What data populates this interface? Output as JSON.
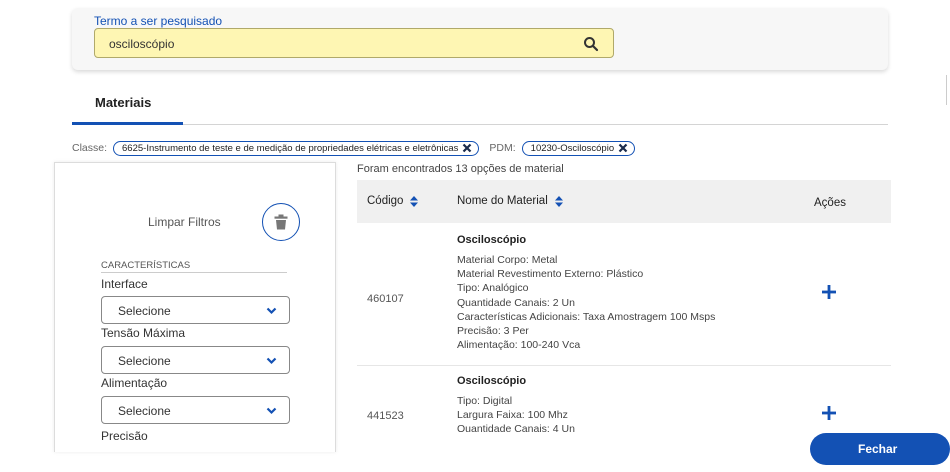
{
  "search": {
    "label": "Termo a ser pesquisado",
    "value": "osciloscópio"
  },
  "tab": {
    "label": "Materiais"
  },
  "filters": {
    "classe_key": "Classe:",
    "classe_value": "6625-Instrumento de teste e de medição de propriedades elétricas e eletrônicas",
    "pdm_key": "PDM:",
    "pdm_value": "10230-Osciloscópio"
  },
  "sidebar": {
    "clear_label": "Limpar Filtros",
    "section_title": "CARACTERÍSTICAS",
    "fields": [
      {
        "label": "Interface",
        "value": "Selecione"
      },
      {
        "label": "Tensão Máxima",
        "value": "Selecione"
      },
      {
        "label": "Alimentação",
        "value": "Selecione"
      },
      {
        "label": "Precisão"
      }
    ]
  },
  "results": {
    "count_text": "Foram encontrados 13 opções de material",
    "columns": {
      "code": "Código",
      "name": "Nome do Material",
      "actions": "Ações"
    },
    "rows": [
      {
        "code": "460107",
        "title": "Osciloscópio",
        "lines": [
          "Material Corpo: Metal",
          "Material Revestimento Externo: Plástico",
          "Tipo: Analógico",
          "Quantidade Canais: 2 Un",
          "Características Adicionais: Taxa Amostragem 100 Msps",
          "Precisão: 3 Per",
          "Alimentação: 100-240 Vca"
        ]
      },
      {
        "code": "441523",
        "title": "Osciloscópio",
        "lines": [
          "Tipo: Digital",
          "Largura Faixa: 100 Mhz",
          "Quantidade Canais: 4 Un"
        ]
      }
    ]
  },
  "footer": {
    "close_label": "Fechar"
  },
  "colors": {
    "primary": "#1351b4",
    "search_bg": "#fef6b3"
  }
}
